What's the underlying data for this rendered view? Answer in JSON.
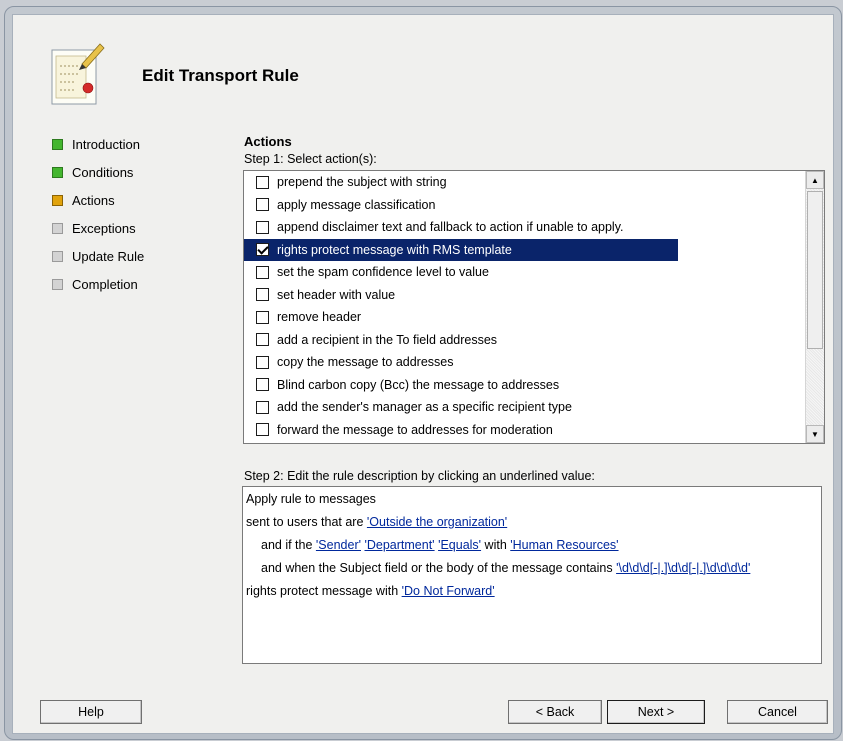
{
  "window": {
    "title": "Edit Transport Rule"
  },
  "nav": {
    "items": [
      {
        "label": "Introduction",
        "status": "completed"
      },
      {
        "label": "Conditions",
        "status": "completed"
      },
      {
        "label": "Actions",
        "status": "current"
      },
      {
        "label": "Exceptions",
        "status": "pending"
      },
      {
        "label": "Update Rule",
        "status": "pending"
      },
      {
        "label": "Completion",
        "status": "pending"
      }
    ]
  },
  "main": {
    "section_title": "Actions",
    "step1_label": "Step 1: Select action(s):",
    "actions": [
      {
        "label": "prepend the subject with string",
        "checked": false
      },
      {
        "label": "apply message classification",
        "checked": false
      },
      {
        "label": "append disclaimer text and fallback to action if unable to apply.",
        "checked": false
      },
      {
        "label": "rights protect message with RMS template",
        "checked": true
      },
      {
        "label": "set the spam confidence level to value",
        "checked": false
      },
      {
        "label": "set header with value",
        "checked": false
      },
      {
        "label": "remove header",
        "checked": false
      },
      {
        "label": "add a recipient in the To field addresses",
        "checked": false
      },
      {
        "label": "copy the message to addresses",
        "checked": false
      },
      {
        "label": "Blind carbon copy (Bcc) the message to addresses",
        "checked": false
      },
      {
        "label": "add the sender's manager as a specific recipient type",
        "checked": false
      },
      {
        "label": "forward the message to addresses for moderation",
        "checked": false
      }
    ],
    "step2_label": "Step 2: Edit the rule description by clicking an underlined value:",
    "description": {
      "line1": "Apply rule to messages",
      "line2_prefix": "sent to users that are ",
      "line2_link": "'Outside the organization'",
      "line3_prefix": "and if the ",
      "line3_link1": "'Sender'",
      "line3_link2": "'Department'",
      "line3_link3": "'Equals'",
      "line3_mid": " with ",
      "line3_link4": "'Human Resources'",
      "line4_prefix": "and when the Subject field or the body of the message contains ",
      "line4_link": "'\\d\\d\\d[-|.]\\d\\d[-|.]\\d\\d\\d\\d'",
      "line5_prefix": "rights protect message with ",
      "line5_link": "'Do Not Forward'"
    }
  },
  "buttons": {
    "help": "Help",
    "back": "< Back",
    "next": "Next >",
    "cancel": "Cancel"
  },
  "colors": {
    "completed": "#44b62f",
    "current": "#e1a30c",
    "pending": "#d3d3d3",
    "selection": "#0a246a",
    "link": "#00289c"
  }
}
